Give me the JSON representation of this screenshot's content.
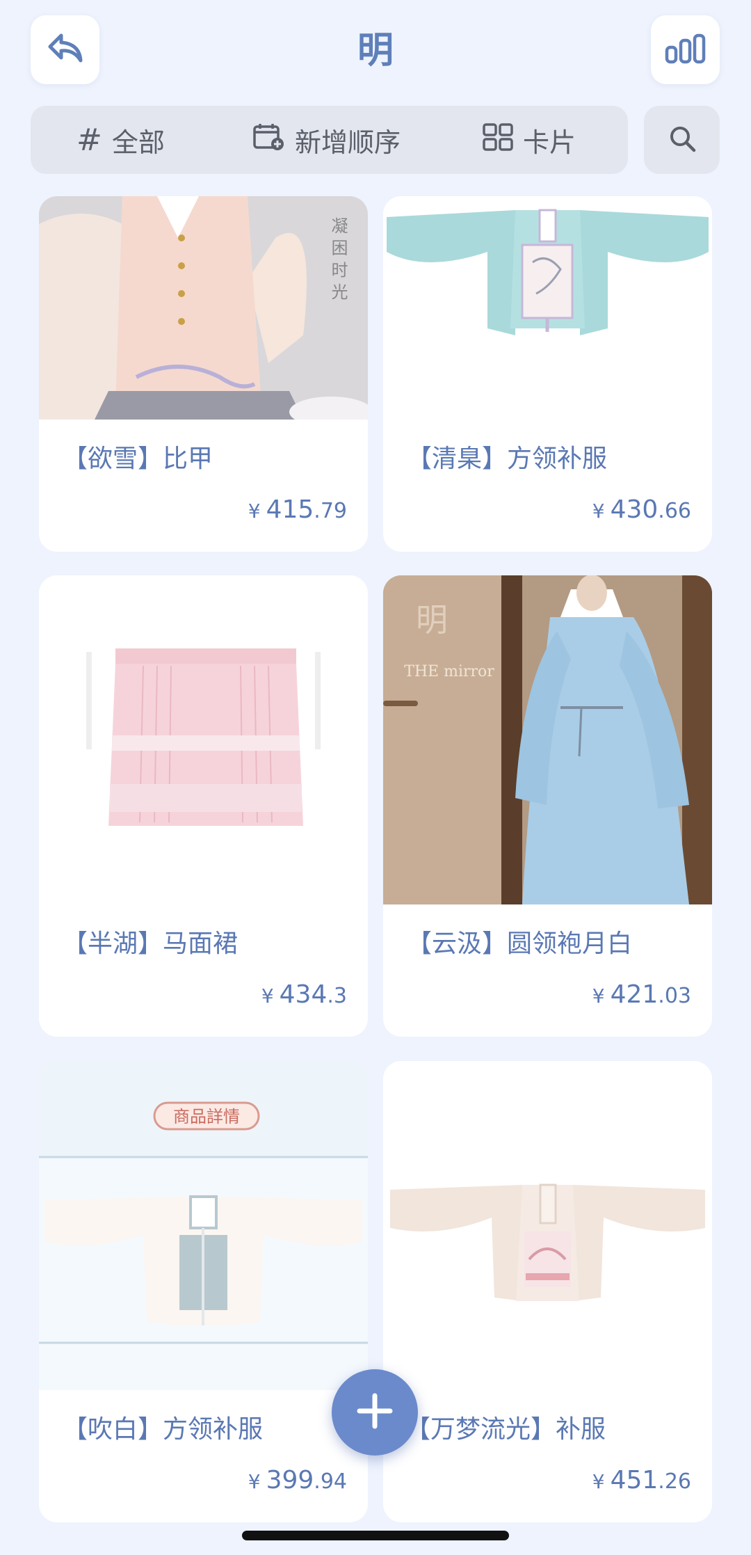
{
  "header": {
    "title": "明",
    "back_icon": "reply-arrow-icon",
    "stats_icon": "bar-chart-icon"
  },
  "toolbar": {
    "filter_label": "全部",
    "sort_label": "新增顺序",
    "view_label": "卡片",
    "search_icon": "search-icon"
  },
  "products": [
    {
      "title": "【欲雪】比甲",
      "price_int": "415",
      "price_dec": ".79"
    },
    {
      "title": "【清臬】方领补服",
      "price_int": "430",
      "price_dec": ".66"
    },
    {
      "title": "【半湖】马面裙",
      "price_int": "434",
      "price_dec": ".3"
    },
    {
      "title": "【云汲】圆领袍月白",
      "price_int": "421",
      "price_dec": ".03"
    },
    {
      "title": "【吹白】方领补服",
      "price_int": "399",
      "price_dec": ".94"
    },
    {
      "title": "【万梦流光】补服",
      "price_int": "451",
      "price_dec": ".26"
    }
  ],
  "currency": "¥",
  "image_texts": {
    "vest_watermark": "凝 困 时 光",
    "mirror_watermark": "THE mirror",
    "detail_banner": "商品詳情"
  },
  "colors": {
    "accent": "#5f7fb9",
    "background": "#eef3fd",
    "fab": "#6a8acb"
  }
}
